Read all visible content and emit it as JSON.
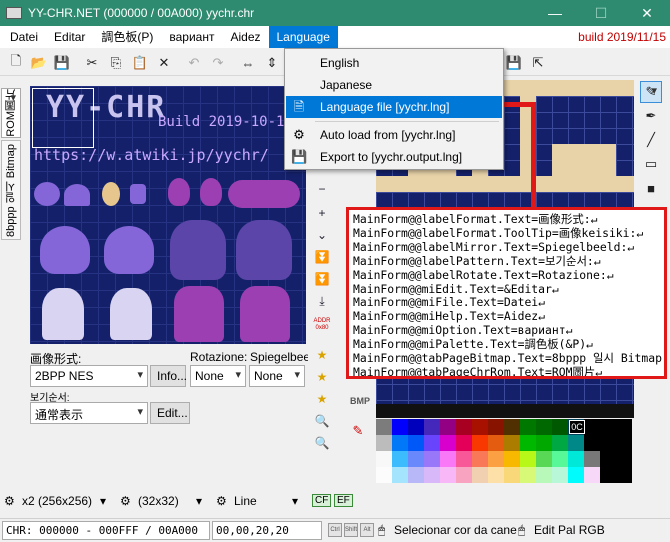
{
  "window": {
    "title": "YY-CHR.NET (000000 / 00A000) yychr.chr",
    "minimize": "—",
    "maximize": "☐",
    "close": "✕"
  },
  "menu": {
    "items": [
      "Datei",
      "Editar",
      "調色板(P)",
      "вариант",
      "Aidez",
      "Language"
    ],
    "active": "Language",
    "build": "build 2019/11/15"
  },
  "language_menu": {
    "items": [
      {
        "label": "English",
        "icon": ""
      },
      {
        "label": "Japanese",
        "icon": ""
      },
      {
        "label": "Language file [yychr.lng]",
        "icon": "document-icon",
        "highlighted": true
      },
      {
        "label": "Auto load from [yychr.lng]",
        "icon": "gear-icon"
      },
      {
        "label": "Export to [yychr.output.lng]",
        "icon": "save-disk-icon"
      }
    ]
  },
  "left_tabs": [
    "ROM圖片",
    "8bppp 일시 Bitmap"
  ],
  "chr_canvas": {
    "logo": "YY-CHR",
    "build": "Build 2019-10-19",
    "url": "https://w.atwiki.jp/yychr/"
  },
  "format": {
    "label": "画像形式:",
    "value": "2BPP NES",
    "info_button": "Info..."
  },
  "rotation": {
    "label": "Rotazione:",
    "value": "None",
    "mirror_label": "Spiegelbeeld",
    "mirror_value": "None"
  },
  "pattern": {
    "label": "보기순서:",
    "value": "通常表示",
    "edit_button": "Edit..."
  },
  "addr_label": "ADDR 0x80",
  "bmp_label": "BMP",
  "callout_lines": [
    "MainForm@@labelFormat.Text=画像形式:↵",
    "MainForm@@labelFormat.ToolTip=画像keisiki:↵",
    "MainForm@@labelMirror.Text=Spiegelbeeld:↵",
    "MainForm@@labelPattern.Text=보기순서:↵",
    "MainForm@@labelRotate.Text=Rotazione:↵",
    "MainForm@@miEdit.Text=&Editar↵",
    "MainForm@@miFile.Text=Datei↵",
    "MainForm@@miHelp.Text=Aidez↵",
    "MainForm@@miOption.Text=вариант↵",
    "MainForm@@miPalette.Text=調色板(&P)↵",
    "MainForm@@tabPageBitmap.Text=8bppp 일시 Bitmap",
    "MainForm@@tabPageChrRom.Text=ROM圖片↵"
  ],
  "palette_marker": "0C",
  "bottom_strip": {
    "zoom": "x2 (256x256)",
    "grid": "(32x32)",
    "tool": "Line",
    "cf": "CF",
    "ef": "EF"
  },
  "status": {
    "chr": "CHR: 000000 - 000FFF / 00A000",
    "coords": "00,00,20,20",
    "keys": [
      "Ctrl",
      "Shift",
      "Alt"
    ],
    "hint1": "Selecionar cor da cane",
    "hint2": "Edit Pal RGB"
  },
  "colors": {
    "titlebar": "#2e8b6f",
    "menu_highlight": "#0078d7",
    "build": "#c00000",
    "callout_border": "#e01818",
    "canvas_bg": "#14216a"
  }
}
